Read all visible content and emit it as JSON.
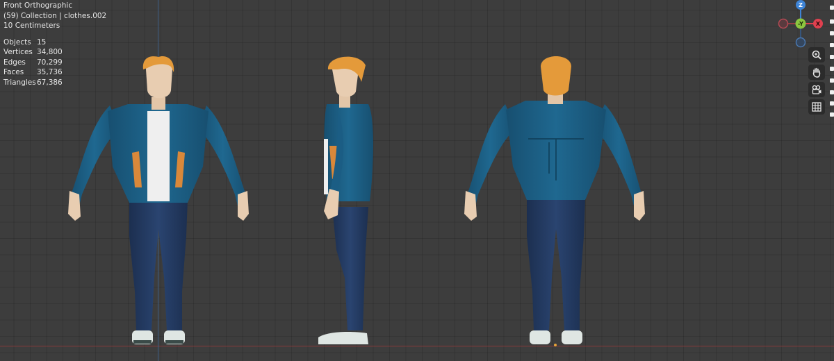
{
  "viewport": {
    "view_name": "Front Orthographic",
    "collection": "(59) Collection | clothes.002",
    "scale": "10 Centimeters"
  },
  "stats": [
    {
      "label": "Objects",
      "value": "15"
    },
    {
      "label": "Vertices",
      "value": "34,800"
    },
    {
      "label": "Edges",
      "value": "70,299"
    },
    {
      "label": "Faces",
      "value": "35,736"
    },
    {
      "label": "Triangles",
      "value": "67,386"
    }
  ],
  "gizmo": {
    "z_label": "Z",
    "y_label": "-Y",
    "x_label": "X",
    "colors": {
      "x": "#e0404f",
      "y": "#8cc63f",
      "z": "#3e84d6"
    }
  },
  "tools": [
    {
      "name": "zoom-icon"
    },
    {
      "name": "hand-pan-icon"
    },
    {
      "name": "camera-view-icon"
    },
    {
      "name": "grid-toggle-icon"
    }
  ],
  "colors": {
    "background": "#3d3d3d",
    "jacket": "#1d5f86",
    "jeans": "#23395e",
    "skin": "#e8cdb1",
    "hair": "#e49a3a",
    "shirt": "#efefef"
  }
}
